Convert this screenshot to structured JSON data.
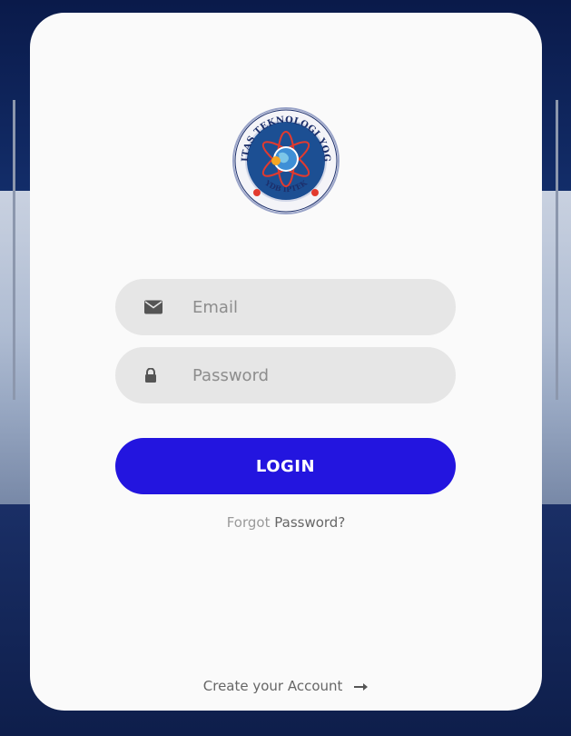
{
  "background": {
    "colors": {
      "sky": "#0a1a4a",
      "building": "#c9d3e2",
      "road": "#0e1e4b"
    }
  },
  "logo": {
    "text_top": "UNIVERSITAS TEKNOLOGI YOGYAKARTA",
    "text_bottom": "YDB IPTEK"
  },
  "form": {
    "email": {
      "placeholder": "Email",
      "icon": "envelope-icon"
    },
    "password": {
      "placeholder": "Password",
      "icon": "lock-icon"
    },
    "login_label": "LOGIN",
    "forgot_prefix": "Forgot",
    "forgot_link": "Password?"
  },
  "footer": {
    "create_account": "Create your Account",
    "arrow_icon": "arrow-right-icon"
  },
  "colors": {
    "card": "#fafafa",
    "input_bg": "#e6e6e6",
    "primary": "#2315df",
    "muted_text": "#9a9a9a",
    "link_text": "#666666"
  }
}
